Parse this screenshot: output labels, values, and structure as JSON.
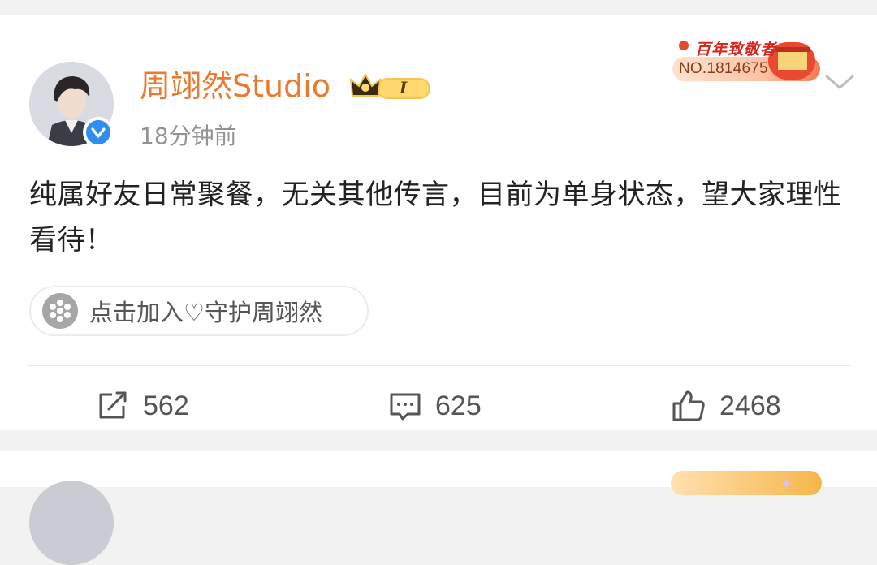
{
  "post": {
    "author": "周翊然Studio",
    "time": "18分钟前",
    "medal_title": "百年致敬者",
    "medal_no": "NO.1814675",
    "badge_level": "I",
    "content": "纯属好友日常聚餐，无关其他传言，目前为单身状态，望大家理性看待！",
    "fan_group": "点击加入♡守护周翊然",
    "actions": {
      "repost_count": "562",
      "comment_count": "625",
      "like_count": "2468"
    }
  },
  "colors": {
    "author_name": "#eb7a2e",
    "verified_blue": "#2f8cf0",
    "meta_gray": "#939393"
  },
  "icons": [
    "verified-icon",
    "crown-badge-icon",
    "chevron-down-icon",
    "fan-group-icon",
    "repost-icon",
    "comment-icon",
    "like-icon"
  ]
}
